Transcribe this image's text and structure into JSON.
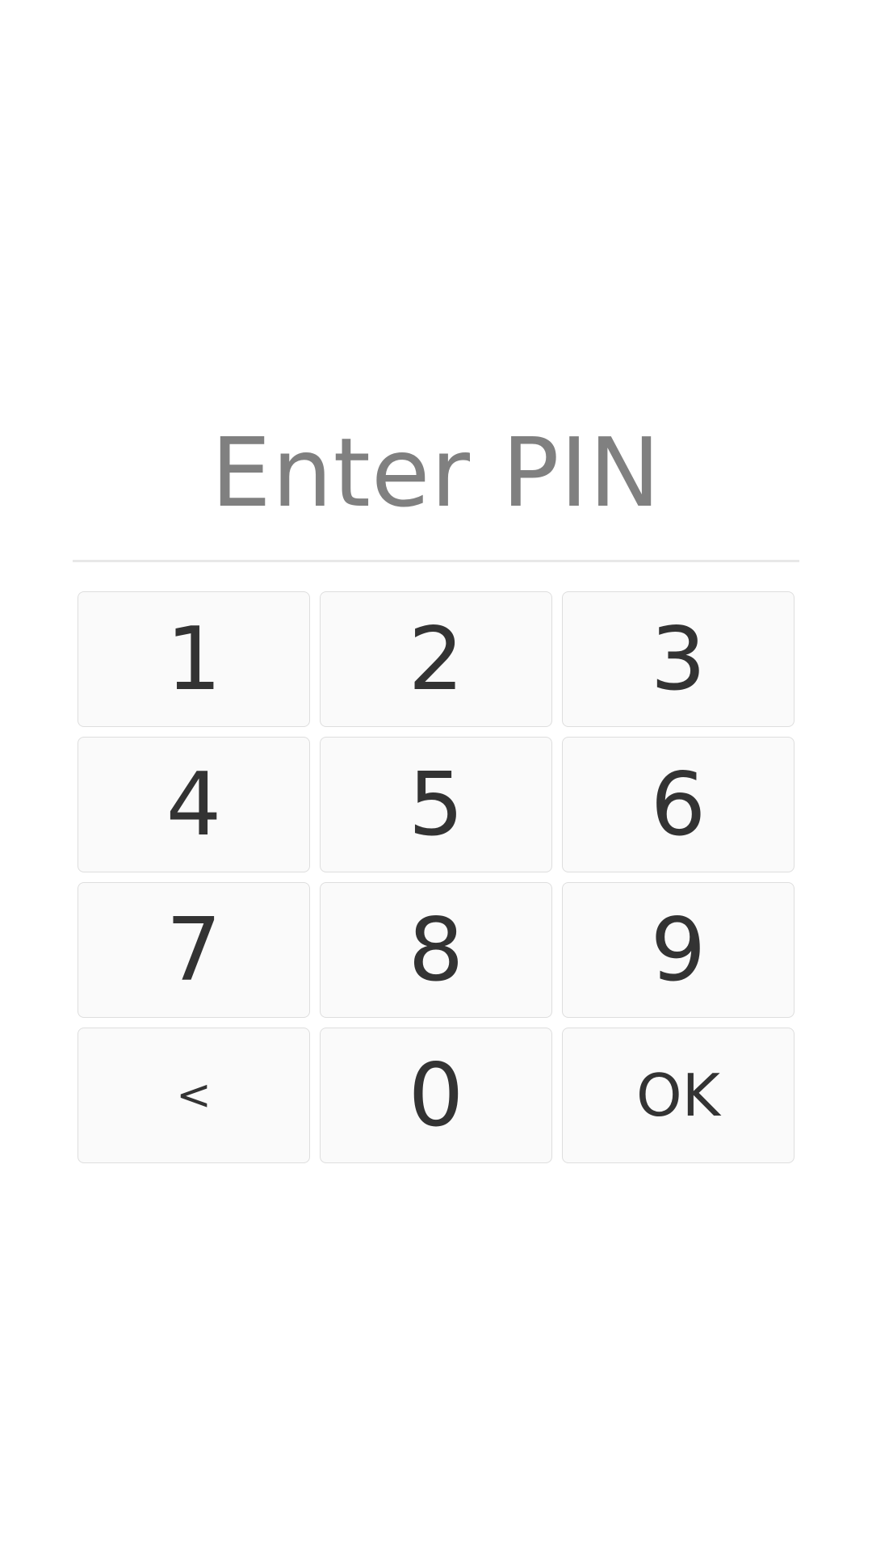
{
  "pin_screen": {
    "title": "Enter PIN"
  },
  "keypad": {
    "keys": [
      {
        "label": "1"
      },
      {
        "label": "2"
      },
      {
        "label": "3"
      },
      {
        "label": "4"
      },
      {
        "label": "5"
      },
      {
        "label": "6"
      },
      {
        "label": "7"
      },
      {
        "label": "8"
      },
      {
        "label": "9"
      },
      {
        "label": "<"
      },
      {
        "label": "0"
      },
      {
        "label": "OK"
      }
    ]
  },
  "colors": {
    "background": "#ffffff",
    "title_text": "#808080",
    "key_text": "#333333",
    "key_border": "#dedede",
    "key_background": "#fafafa",
    "divider": "#e8e8e8"
  }
}
